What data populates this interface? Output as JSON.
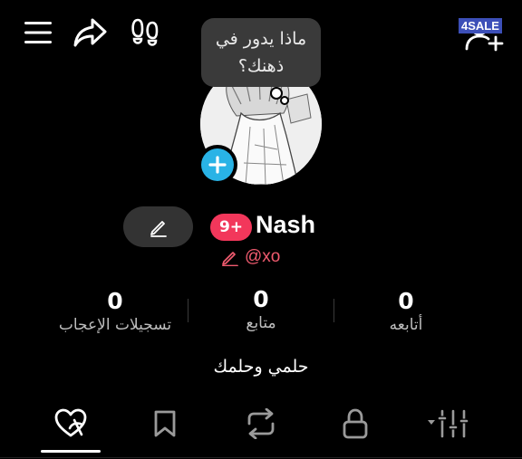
{
  "bubble": {
    "text": "ماذا يدور في ذهنك؟"
  },
  "profile": {
    "notification_badge": "9+",
    "display_name": "Nash",
    "handle": "@xo"
  },
  "stats": [
    {
      "value": "0",
      "label": "أتابعه"
    },
    {
      "value": "0",
      "label": "متابع"
    },
    {
      "value": "0",
      "label": "تسجيلات الإعجاب"
    }
  ],
  "bio": "حلمي وحلمك",
  "watermark": "4SALE",
  "tabs": [
    {
      "icon": "liked-heart-icon",
      "active": true
    },
    {
      "icon": "bookmark-icon",
      "active": false
    },
    {
      "icon": "repost-icon",
      "active": false
    },
    {
      "icon": "lock-icon",
      "active": false
    },
    {
      "icon": "filter-sliders-icon",
      "active": false
    }
  ],
  "top_bar": {
    "icons": [
      "menu-icon",
      "share-icon",
      "footprints-icon",
      "add-user-icon"
    ]
  },
  "colors": {
    "background": "#000000",
    "badge": "#f2375b",
    "handle": "#f05b6f",
    "add_avatar": "#29b3e6",
    "pill": "#333333"
  }
}
